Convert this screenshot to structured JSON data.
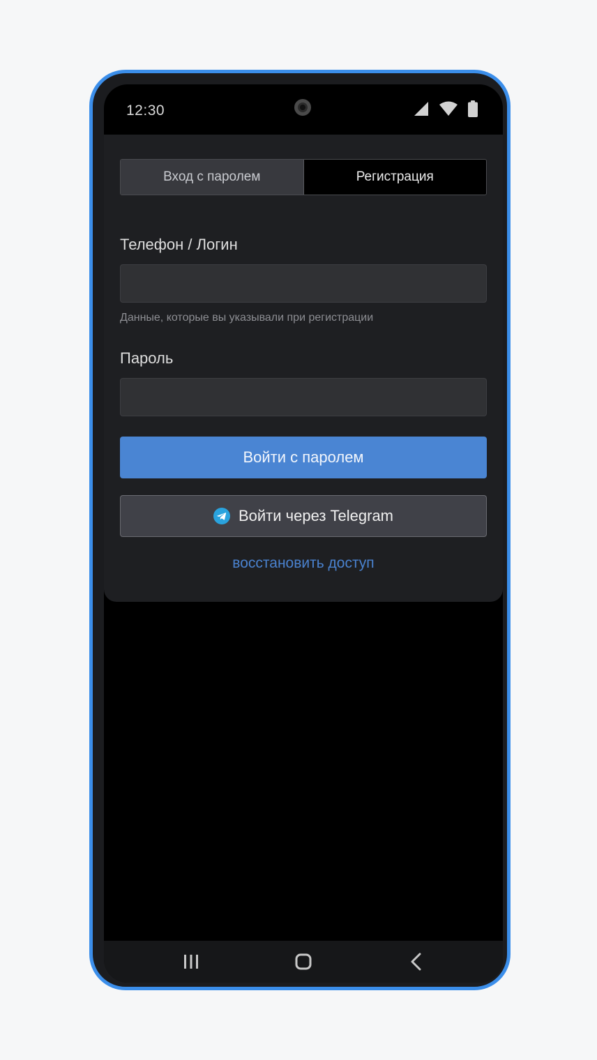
{
  "status_bar": {
    "time": "12:30",
    "icons": [
      "signal-icon",
      "wifi-icon",
      "battery-icon"
    ]
  },
  "tabs": [
    {
      "label": "Вход с паролем",
      "active": true
    },
    {
      "label": "Регистрация",
      "active": false
    }
  ],
  "login_form": {
    "login_label": "Телефон / Логин",
    "login_value": "",
    "login_hint": "Данные, которые вы указывали при регистрации",
    "password_label": "Пароль",
    "password_value": "",
    "submit_label": "Войти с паролем",
    "telegram_label": "Войти через Telegram",
    "restore_label": "восстановить доступ"
  },
  "nav_bar": {
    "icons": [
      "recent-apps-icon",
      "home-icon",
      "back-icon"
    ]
  },
  "colors": {
    "frame": "#3b8eea",
    "primary_button": "#4a85d3",
    "link": "#4a82cf",
    "telegram": "#2aa3de"
  }
}
